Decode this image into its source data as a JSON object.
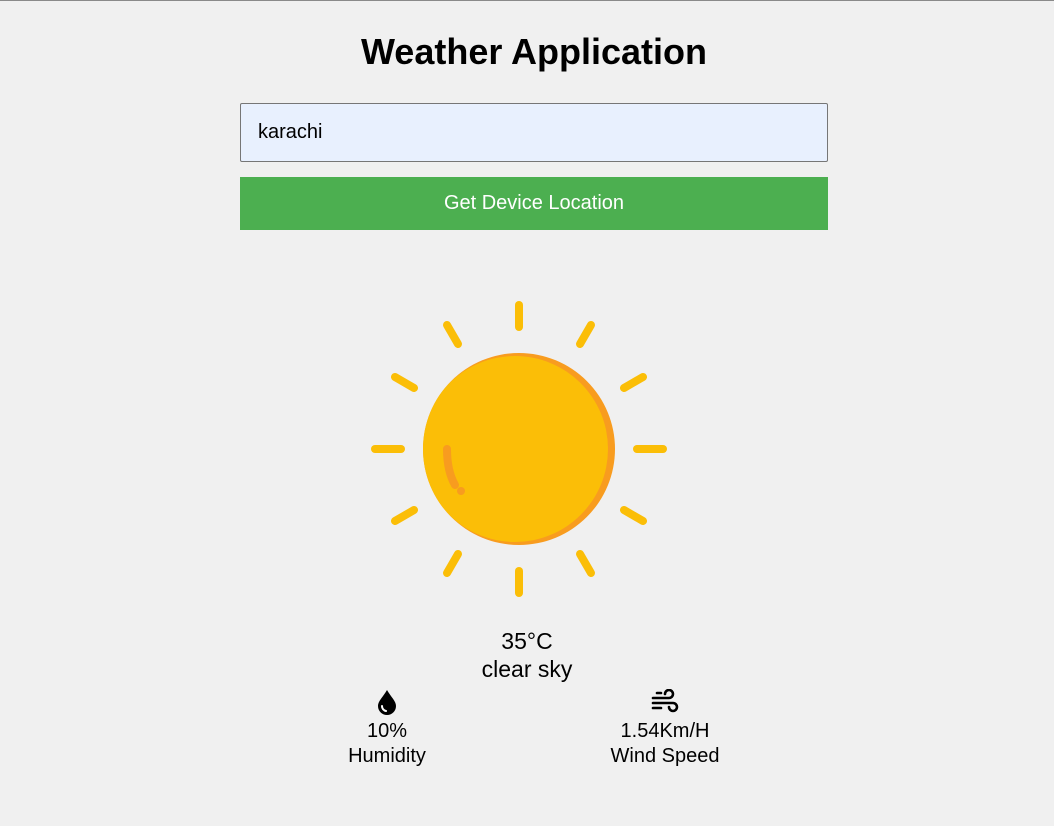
{
  "app": {
    "title": "Weather Application"
  },
  "search": {
    "value": "karachi"
  },
  "location_button": {
    "label": "Get Device Location"
  },
  "weather": {
    "icon": "sun-icon",
    "temperature": "35°C",
    "description": "clear sky"
  },
  "stats": {
    "humidity": {
      "icon": "water-drop-icon",
      "value": "10%",
      "label": "Humidity"
    },
    "wind": {
      "icon": "wind-icon",
      "value": "1.54Km/H",
      "label": "Wind Speed"
    }
  },
  "colors": {
    "button_bg": "#4caf50",
    "input_bg": "#e8f0fe",
    "sun_main": "#fbbe07",
    "sun_shadow": "#f89c1f",
    "page_bg": "#f0f0f0"
  }
}
